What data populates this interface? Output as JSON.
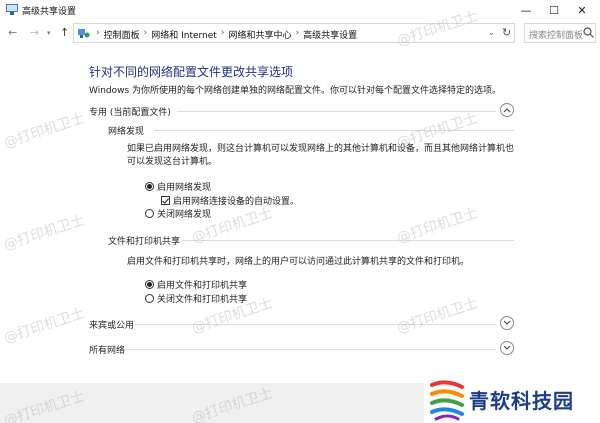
{
  "window": {
    "title": "高级共享设置",
    "minimize_glyph": "—",
    "maximize_glyph": "☐",
    "close_glyph": "✕"
  },
  "nav": {
    "back_glyph": "←",
    "forward_glyph": "→",
    "history_glyph": "▾",
    "up_glyph": "↑"
  },
  "address": {
    "breadcrumbs": [
      "控制面板",
      "网络和 Internet",
      "网络和共享中心",
      "高级共享设置"
    ],
    "separator": "›",
    "lead_separator": "›",
    "dropdown_glyph": "⌄",
    "refresh_glyph": "↻"
  },
  "search": {
    "placeholder": "搜索控制面板"
  },
  "page": {
    "heading": "针对不同的网络配置文件更改共享选项",
    "description": "Windows 为你所使用的每个网络创建单独的网络配置文件。你可以针对每个配置文件选择特定的选项。"
  },
  "sections": {
    "private": {
      "label": "专用 (当前配置文件)",
      "expanded": true,
      "network_discovery": {
        "label": "网络发现",
        "description_lines": [
          "如果已启用网络发现，则这台计算机可以发现网络上的其他计算机和设备，而且其他网络计算机也",
          "可以发现这台计算机。"
        ],
        "option_on": "启用网络发现",
        "option_auto": "启用网络连接设备的自动设置。",
        "option_off": "关闭网络发现",
        "selected": "on",
        "auto_checked": true
      },
      "file_printer_sharing": {
        "label": "文件和打印机共享",
        "description": "启用文件和打印机共享时，网络上的用户可以访问通过此计算机共享的文件和打印机。",
        "option_on": "启用文件和打印机共享",
        "option_off": "关闭文件和打印机共享",
        "selected": "on"
      }
    },
    "guest_public": {
      "label": "来宾或公用",
      "expanded": false
    },
    "all_networks": {
      "label": "所有网络",
      "expanded": false
    }
  },
  "watermark": "@打印机卫士",
  "brand": {
    "text": "青软科技园"
  },
  "colors": {
    "heading": "#1e3287",
    "brand_blue": "#1c3d8c",
    "footer_bg": "#f0f0f0"
  },
  "icons": {
    "app": "network-settings-icon",
    "control_panel": "control-panel-icon",
    "search": "search-icon",
    "chevron_up": "chevron-up-icon",
    "chevron_down": "chevron-down-icon"
  }
}
